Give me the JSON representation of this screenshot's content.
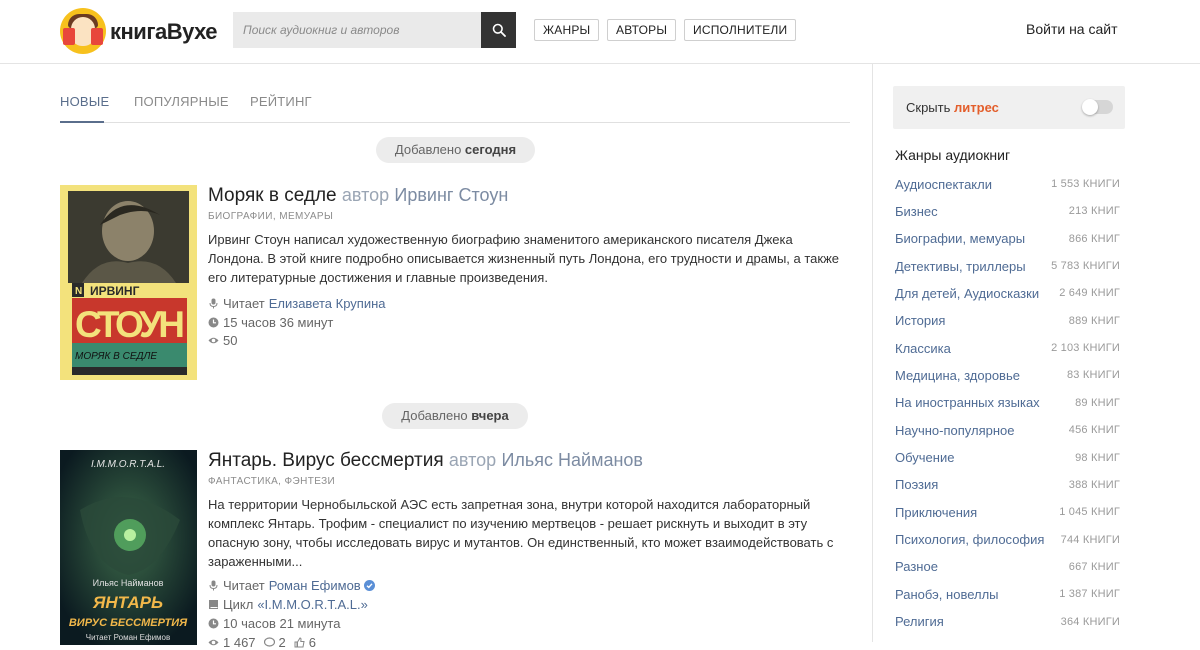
{
  "header": {
    "logo_text": "книгаВухе",
    "search_placeholder": "Поиск аудиокниг и авторов",
    "nav": [
      "ЖАНРЫ",
      "АВТОРЫ",
      "ИСПОЛНИТЕЛИ"
    ],
    "login": "Войти на сайт"
  },
  "tabs": [
    "НОВЫЕ",
    "ПОПУЛЯРНЫЕ",
    "РЕЙТИНГ"
  ],
  "active_tab": "НОВЫЕ",
  "groups": [
    {
      "prefix": "Добавлено",
      "day": "сегодня"
    },
    {
      "prefix": "Добавлено",
      "day": "вчера"
    }
  ],
  "books": [
    {
      "title": "Моряк в седле",
      "by": "автор",
      "author": "Ирвинг Стоун",
      "genre": "БИОГРАФИИ, МЕМУАРЫ",
      "description": "Ирвинг Стоун написал художественную биографию знаменитого американского писателя Джека Лондона. В этой книге подробно описывается жизненный путь Лондона, его трудности и драмы, а также его литературные достижения и главные произведения.",
      "reader_label": "Читает",
      "reader": "Елизавета Крупина",
      "duration": "15 часов 36 минут",
      "views": "50",
      "cover": {
        "author_line1": "ИРВИНГ",
        "author_line2": "СТОУН",
        "title": "МОРЯК В СЕДЛЕ"
      }
    },
    {
      "title": "Янтарь. Вирус бессмертия",
      "by": "автор",
      "author": "Ильяс Найманов",
      "genre": "ФАНТАСТИКА, ФЭНТЕЗИ",
      "description": "На территории Чернобыльской АЭС есть запретная зона, внутри которой находится лабораторный комплекс Янтарь. Трофим - специалист по изучению мертвецов - решает рискнуть и выходит в эту опасную зону, чтобы исследовать вирус и мутантов. Он единственный, кто может взаимодействовать с зараженными...",
      "reader_label": "Читает",
      "reader": "Роман Ефимов",
      "cycle_label": "Цикл",
      "cycle": "«I.M.M.O.R.T.A.L.»",
      "duration": "10 часов 21 минута",
      "views": "1 467",
      "comments": "2",
      "likes": "6",
      "cover": {
        "series": "I.M.M.O.R.T.A.L.",
        "author": "Ильяс Найманов",
        "title1": "ЯНТАРЬ",
        "title2": "ВИРУС БЕССМЕРТИЯ",
        "reader": "Читает Роман Ефимов"
      }
    }
  ],
  "sidebar": {
    "litres_prefix": "Скрыть",
    "litres_logo": "литрес",
    "genres_title": "Жанры аудиокниг",
    "genres": [
      {
        "name": "Аудиоспектакли",
        "count": "1 553 КНИГИ"
      },
      {
        "name": "Бизнес",
        "count": "213 КНИГ"
      },
      {
        "name": "Биографии, мемуары",
        "count": "866 КНИГ"
      },
      {
        "name": "Детективы, триллеры",
        "count": "5 783 КНИГИ"
      },
      {
        "name": "Для детей, Аудиосказки",
        "count": "2 649 КНИГ"
      },
      {
        "name": "История",
        "count": "889 КНИГ"
      },
      {
        "name": "Классика",
        "count": "2 103 КНИГИ"
      },
      {
        "name": "Медицина, здоровье",
        "count": "83 КНИГИ"
      },
      {
        "name": "На иностранных языках",
        "count": "89 КНИГ"
      },
      {
        "name": "Научно-популярное",
        "count": "456 КНИГ"
      },
      {
        "name": "Обучение",
        "count": "98 КНИГ"
      },
      {
        "name": "Поэзия",
        "count": "388 КНИГ"
      },
      {
        "name": "Приключения",
        "count": "1 045 КНИГ"
      },
      {
        "name": "Психология, философия",
        "count": "744 КНИГИ"
      },
      {
        "name": "Разное",
        "count": "667 КНИГ"
      },
      {
        "name": "Ранобэ, новеллы",
        "count": "1 387 КНИГ"
      },
      {
        "name": "Религия",
        "count": "364 КНИГИ"
      }
    ]
  }
}
